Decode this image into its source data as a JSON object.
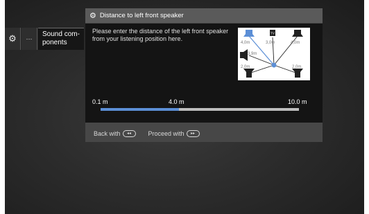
{
  "nav": {
    "gear_icon": "gear-icon",
    "more_label": "···",
    "sound_label_1": "Sound com-",
    "sound_label_2": "ponents"
  },
  "dialog": {
    "title": "Distance to left front speaker",
    "title_icon": "gears-icon",
    "instruction": "Please enter the distance of the left front speaker from your listening position here.",
    "diagram": {
      "tv_label": "TV",
      "distances": {
        "front_left": "4,0m",
        "center": "3,0m",
        "front_right": "4,0m",
        "side_left": "3,9m",
        "rear_left": "2,0m",
        "rear_right": "2,0m"
      }
    },
    "slider": {
      "min_label": "0.1 m",
      "current_label": "4.0 m",
      "max_label": "10.0 m",
      "min": 0.1,
      "max": 10.0,
      "value": 4.0,
      "fill_color": "#5c8fd6"
    },
    "footer": {
      "back_label": "Back with",
      "back_key": "◂◂",
      "proceed_label": "Proceed with",
      "proceed_key": "▸▸"
    }
  }
}
